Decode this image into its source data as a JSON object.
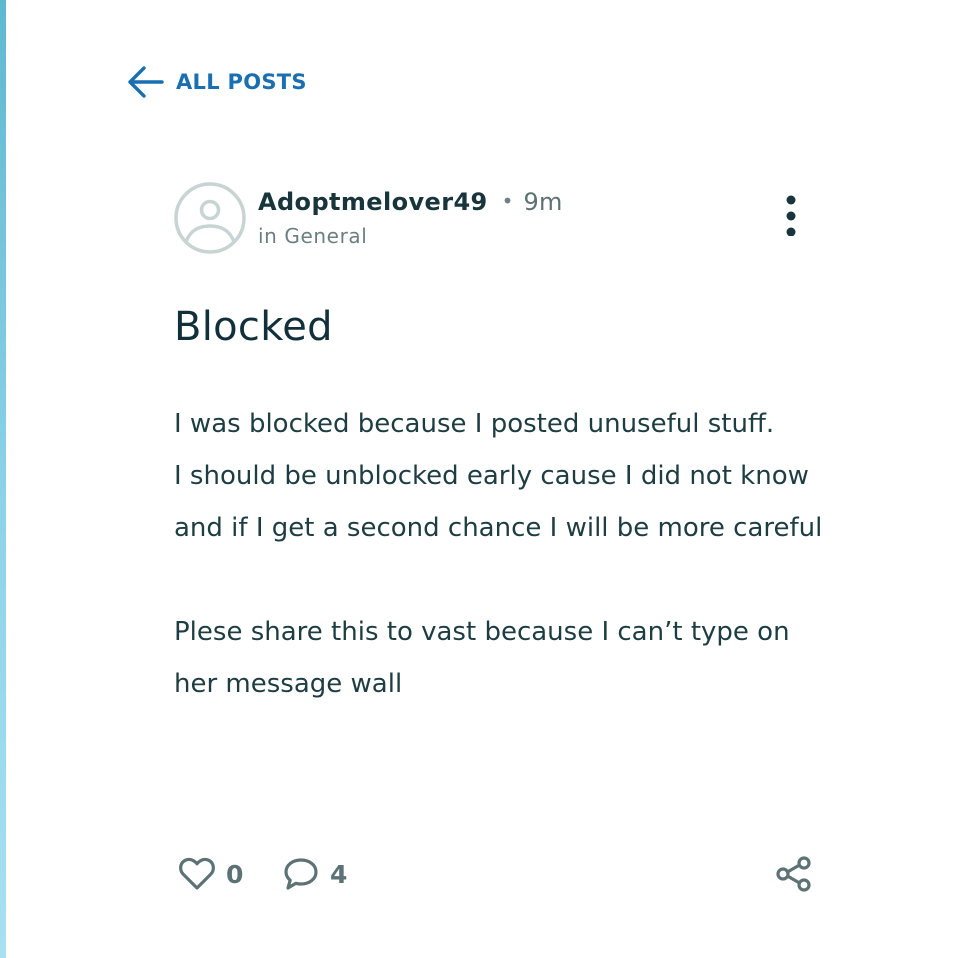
{
  "navigation": {
    "back_label": "ALL POSTS"
  },
  "post": {
    "author": "Adoptmelover49",
    "separator": "•",
    "time_ago": "9m",
    "category": "in General",
    "title": "Blocked",
    "body": {
      "line1": "I was blocked because I posted unuseful stuff.",
      "line2": "I should be unblocked early cause I did not know and if I get a second chance I will be more careful",
      "line3": "Plese share this to vast because I can’t type on her message wall"
    },
    "likes": "0",
    "comments": "4"
  },
  "colors": {
    "link_blue": "#1a6fb0",
    "text_dark": "#17353a",
    "muted": "#5d7275",
    "avatar_gray": "#c7d4d3",
    "edge_accent": "#8fd3ea"
  },
  "icons": {
    "back": "arrow-left-icon",
    "avatar": "user-avatar-icon",
    "more": "vertical-dots-icon",
    "like": "heart-icon",
    "comment": "speech-bubble-icon",
    "share": "share-nodes-icon"
  }
}
